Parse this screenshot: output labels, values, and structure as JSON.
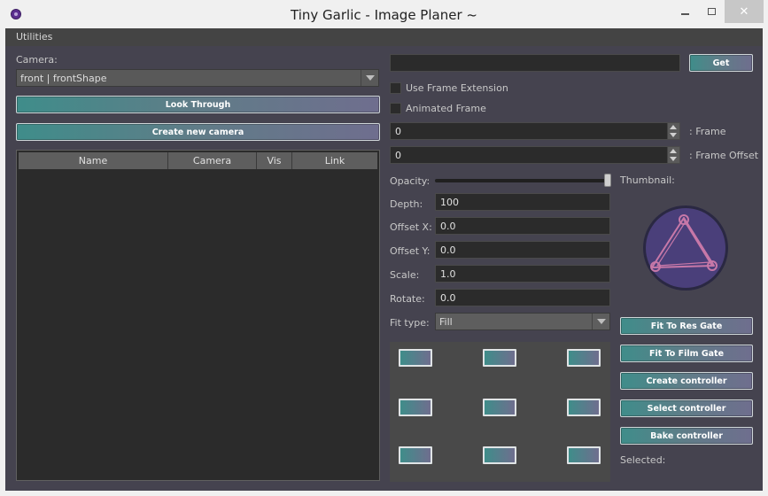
{
  "window": {
    "title": "Tiny Garlic - Image Planer ~"
  },
  "menu": {
    "utilities": "Utilities"
  },
  "left": {
    "camera_label": "Camera:",
    "camera_value": "front | frontShape",
    "look_through": "Look Through",
    "create_camera": "Create new camera",
    "table_columns": [
      "Name",
      "Camera",
      "Vis",
      "Link"
    ]
  },
  "right": {
    "path_value": "",
    "get_button": "Get",
    "use_frame_extension": "Use Frame Extension",
    "animated_frame": "Animated Frame",
    "frame_value": "0",
    "frame_label": ": Frame",
    "frame_offset_value": "0",
    "frame_offset_label": ": Frame Offset",
    "opacity_label": "Opacity:",
    "opacity_level": 1.0,
    "thumbnail_label": "Thumbnail:",
    "depth_label": "Depth:",
    "depth_value": "100",
    "offset_x_label": "Offset X:",
    "offset_x_value": "0.0",
    "offset_y_label": "Offset Y:",
    "offset_y_value": "0.0",
    "scale_label": "Scale:",
    "scale_value": "1.0",
    "rotate_label": "Rotate:",
    "rotate_value": "0.0",
    "fit_type_label": "Fit type:",
    "fit_type_value": "Fill",
    "fit_res_gate": "Fit To Res Gate",
    "fit_film_gate": "Fit To Film Gate",
    "create_controller": "Create controller",
    "select_controller": "Select controller",
    "bake_controller": "Bake controller",
    "selected_label": "Selected:"
  },
  "colors": {
    "panel_bg": "#45434f",
    "button_teal": "#3f8d8a",
    "button_purple": "#6f6e8e"
  },
  "icons": {
    "app": "maya-icon",
    "thumbnail": "image-plane-logo"
  }
}
